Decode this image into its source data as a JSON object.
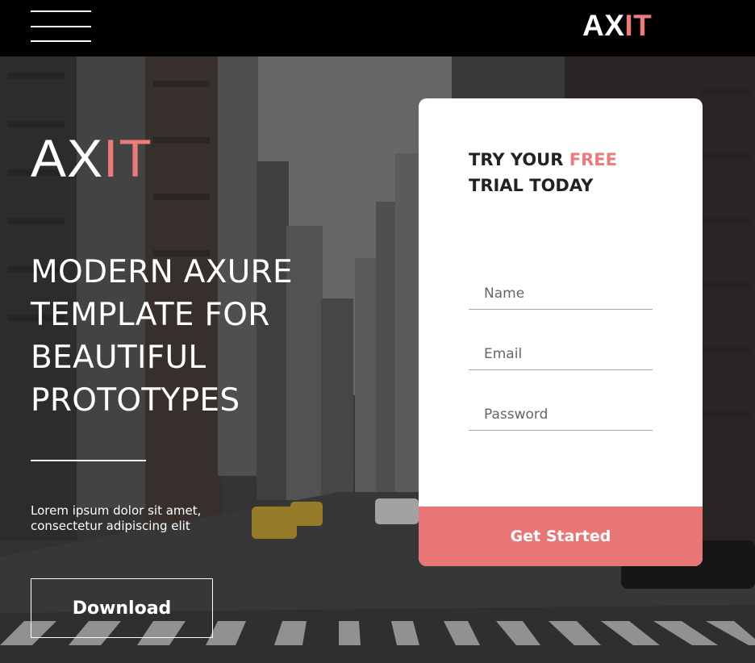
{
  "header": {
    "menu_icon": "hamburger-menu-icon",
    "logo_white": "AX",
    "logo_accent": "IT"
  },
  "hero": {
    "logo_white": "AX",
    "logo_accent": "IT",
    "headline": "MODERN AXURE TEMPLATE FOR BEAUTIFUL PROTOTYPES",
    "description": "Lorem ipsum dolor sit amet, consectetur adipiscing elit",
    "download_label": "Download"
  },
  "form": {
    "title_part1": "TRY YOUR ",
    "title_highlight": "FREE",
    "title_part2": "TRIAL TODAY",
    "name_placeholder": "Name",
    "email_placeholder": "Email",
    "password_placeholder": "Password",
    "submit_label": "Get Started"
  },
  "colors": {
    "accent": "#ee7b7b",
    "button": "#e87676",
    "topbar": "#000000"
  }
}
